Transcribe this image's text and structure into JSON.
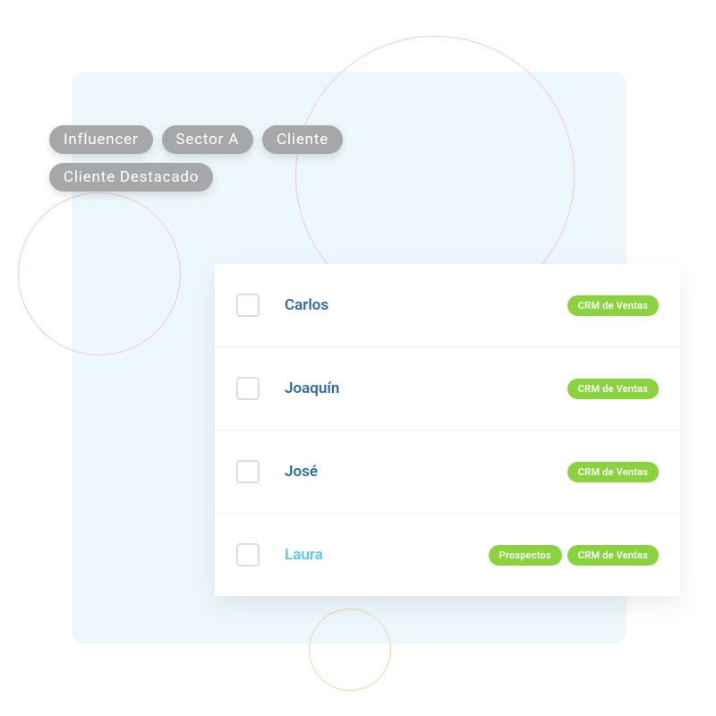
{
  "filters": {
    "tags": [
      "Influencer",
      "Sector A",
      "Cliente",
      "Cliente Destacado"
    ]
  },
  "contacts": [
    {
      "name": "Carlos",
      "highlighted": false,
      "tags": [
        "CRM de Ventas"
      ]
    },
    {
      "name": "Joaquín",
      "highlighted": false,
      "tags": [
        "CRM de Ventas"
      ]
    },
    {
      "name": "José",
      "highlighted": false,
      "tags": [
        "CRM de Ventas"
      ]
    },
    {
      "name": "Laura",
      "highlighted": true,
      "tags": [
        "Prospectos",
        "CRM de Ventas"
      ]
    }
  ],
  "colors": {
    "panel_bg": "#ecf8fb",
    "tag_bg": "#a6a7a9",
    "badge_bg": "#8bd23f",
    "name_default": "#2f6aa0",
    "name_active": "#56c7e8"
  }
}
